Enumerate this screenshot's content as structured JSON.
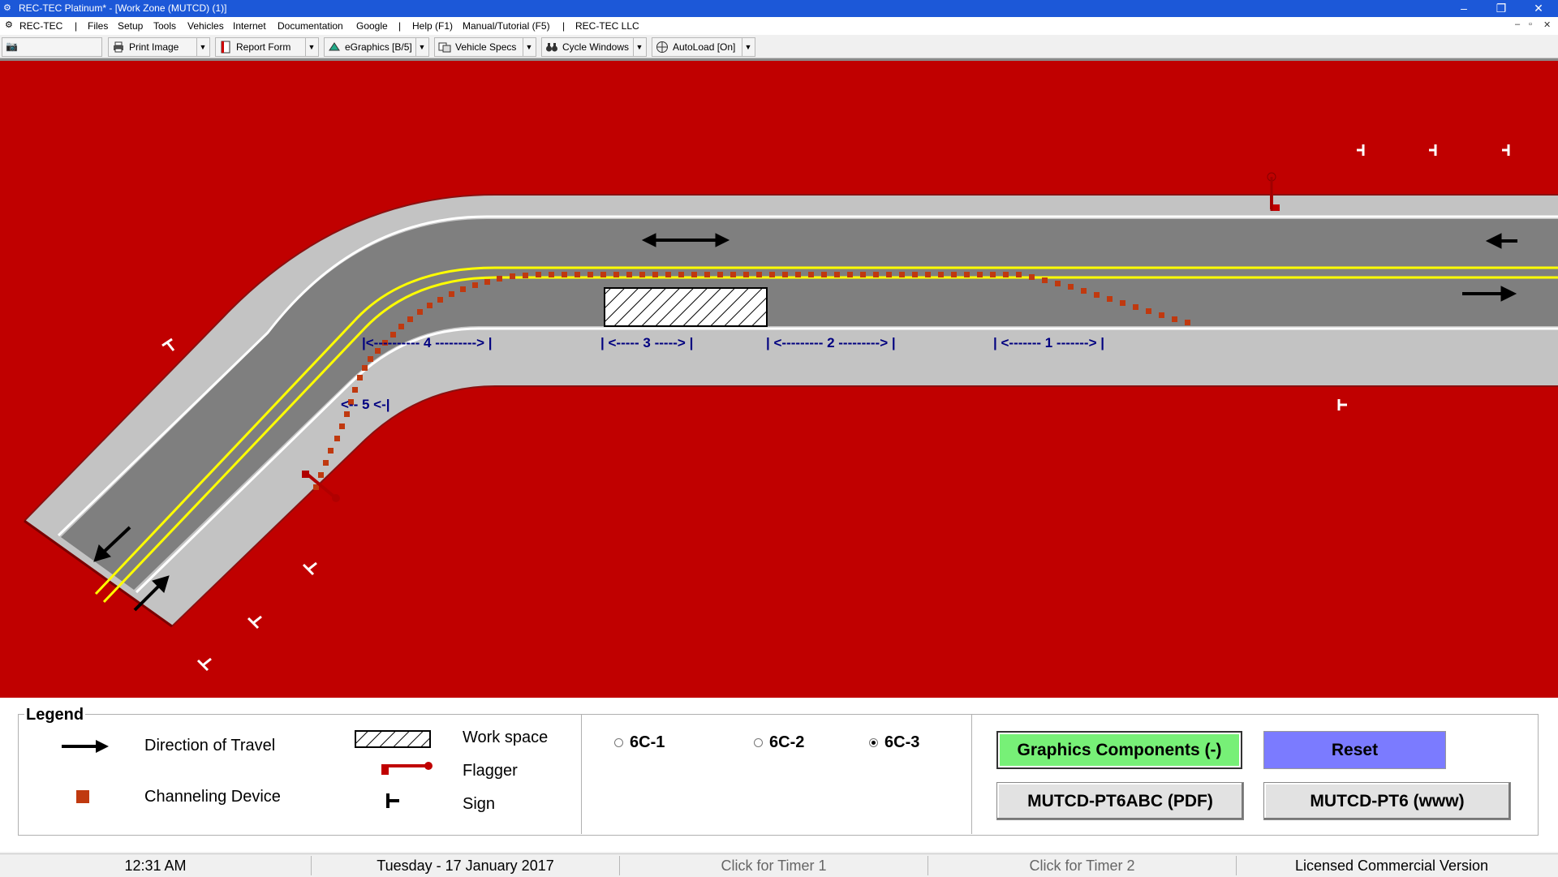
{
  "window": {
    "title": "REC-TEC Platinum* - [Work Zone (MUTCD) (1)]",
    "min": "–",
    "max": "❐",
    "close": "✕"
  },
  "menu": {
    "items": [
      "REC-TEC",
      "|",
      "Files",
      "Setup",
      "Tools",
      "Vehicles",
      "Internet",
      "Documentation",
      "Google",
      "|",
      "Help (F1)",
      "Manual/Tutorial (F5)",
      "|",
      "REC-TEC LLC"
    ],
    "mdi_min": "–",
    "mdi_restore": "▫",
    "mdi_close": "✕"
  },
  "toolbar": {
    "print_image": "Print Image",
    "report_form": "Report Form",
    "egraphics": "eGraphics [B/5]",
    "vehicle_specs": "Vehicle Specs",
    "cycle_windows": "Cycle Windows",
    "autoload": "AutoLoad [On]",
    "dropdown_glyph": "▼"
  },
  "diagram": {
    "background_color": "#c00000",
    "road_color": "#7f7f7f",
    "shoulder_color": "#c3c3c3",
    "centerline_color": "#ffff00",
    "device_color": "#c0390f",
    "zone_label_color": "#000080",
    "zones": [
      {
        "id": "zone-4",
        "text": "|<---------- 4 ---------> |"
      },
      {
        "id": "zone-3",
        "text": "| <----- 3 -----> |"
      },
      {
        "id": "zone-2",
        "text": "| <--------- 2 ---------> |"
      },
      {
        "id": "zone-1",
        "text": "| <------- 1 -------> |"
      },
      {
        "id": "zone-5",
        "text": "<-- 5 <-|"
      }
    ]
  },
  "legend": {
    "title": "Legend",
    "direction_of_travel": "Direction of Travel",
    "channeling_device": "Channeling Device",
    "work_space": "Work space",
    "flagger": "Flagger",
    "sign": "Sign"
  },
  "options": {
    "radio": [
      {
        "label": "6C-1",
        "selected": false
      },
      {
        "label": "6C-2",
        "selected": false
      },
      {
        "label": "6C-3",
        "selected": true
      }
    ]
  },
  "buttons": {
    "graphics_components": "Graphics Components (-)",
    "reset": "Reset",
    "mutcd_pdf": "MUTCD-PT6ABC (PDF)",
    "mutcd_www": "MUTCD-PT6 (www)",
    "colors": {
      "green": "#77f077",
      "blue": "#7b7bff"
    }
  },
  "status": {
    "time": "12:31 AM",
    "date": "Tuesday  -  17 January 2017",
    "timer1": "Click for Timer 1",
    "timer2": "Click for Timer 2",
    "license": "Licensed Commercial Version"
  }
}
